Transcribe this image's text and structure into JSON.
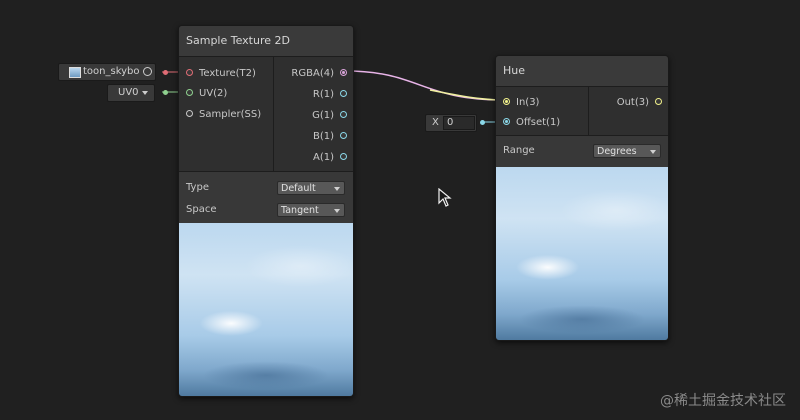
{
  "sample_texture": {
    "title": "Sample Texture 2D",
    "inputs": [
      "Texture(T2)",
      "UV(2)",
      "Sampler(SS)"
    ],
    "outputs": [
      "RGBA(4)",
      "R(1)",
      "G(1)",
      "B(1)",
      "A(1)"
    ],
    "props": [
      {
        "label": "Type",
        "value": "Default"
      },
      {
        "label": "Space",
        "value": "Tangent"
      }
    ]
  },
  "texture_input": {
    "value": "toon_skybo"
  },
  "uv_input": {
    "value": "UV0"
  },
  "hue": {
    "title": "Hue",
    "inputs": [
      "In(3)",
      "Offset(1)"
    ],
    "outputs": [
      "Out(3)"
    ],
    "props": [
      {
        "label": "Range",
        "value": "Degrees"
      }
    ]
  },
  "offset_input": {
    "axis": "X",
    "value": "0"
  },
  "watermark": "@稀土掘金技术社区",
  "colors": {
    "texture_port": "#e06c75",
    "vector2_port": "#8fd18f",
    "vector4_port": "#d8a2d8",
    "vector3_port": "#f0f08a",
    "vector1_port": "#8ad7e8",
    "wire_rgba": "#e8b4e8",
    "wire_yellow": "#f0f0a0"
  }
}
